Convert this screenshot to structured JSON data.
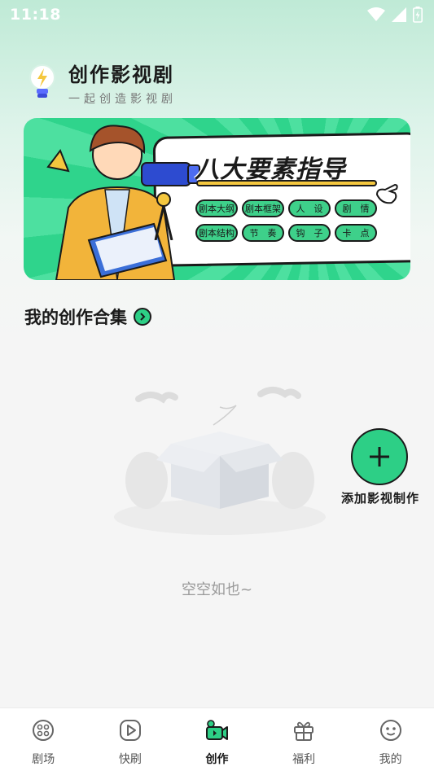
{
  "status_bar": {
    "time": "11:18"
  },
  "header": {
    "title": "创作影视剧",
    "subtitle": "一起创造影视剧"
  },
  "banner": {
    "headline": "八大要素指导",
    "chips": [
      "剧本大纲",
      "剧本框架",
      "人　设",
      "剧　情",
      "剧本结构",
      "节　奏",
      "钩　子",
      "卡　点"
    ]
  },
  "section": {
    "title": "我的创作合集"
  },
  "empty_state": {
    "text": "空空如也~"
  },
  "fab": {
    "label": "添加影视制作"
  },
  "tabbar": {
    "tabs": [
      {
        "label": "剧场",
        "icon": "theater-icon"
      },
      {
        "label": "快刷",
        "icon": "play-icon"
      },
      {
        "label": "创作",
        "icon": "camera-icon",
        "active": true
      },
      {
        "label": "福利",
        "icon": "gift-icon"
      },
      {
        "label": "我的",
        "icon": "face-icon"
      }
    ]
  },
  "colors": {
    "accent": "#2dcf86",
    "text": "#1a1a1a",
    "muted": "#9a9a9a"
  }
}
